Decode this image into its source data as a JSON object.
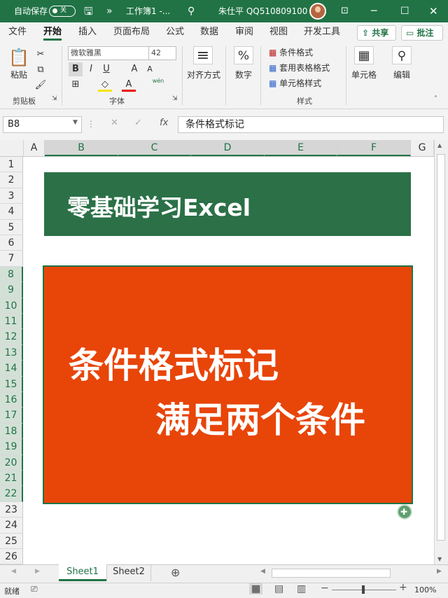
{
  "titlebar": {
    "autosave_label": "自动保存",
    "autosave_state": "关",
    "filename": "工作簿1 -...",
    "user": "朱仕平 QQ510809100",
    "chevron": "»"
  },
  "tabs": [
    "文件",
    "开始",
    "插入",
    "页面布局",
    "公式",
    "数据",
    "审阅",
    "视图",
    "开发工具"
  ],
  "active_tab": "开始",
  "share_label": "共享",
  "comment_label": "批注",
  "ribbon": {
    "paste": "粘贴",
    "clipboard": "剪贴板",
    "font_name": "微软雅黑",
    "font_size": "42",
    "font_group": "字体",
    "align": "对齐方式",
    "number": "数字",
    "number_symbol": "%",
    "cond_format": "条件格式",
    "table_format": "套用表格格式",
    "cell_style": "单元格样式",
    "styles_group": "样式",
    "cells": "单元格",
    "edit": "编辑",
    "bold": "B",
    "italic": "I",
    "underline": "U",
    "grow": "A",
    "shrink": "A",
    "wen": "wén"
  },
  "formula_bar": {
    "namebox": "B8",
    "fx": "fx",
    "formula": "条件格式标记"
  },
  "columns": [
    "A",
    "B",
    "C",
    "D",
    "E",
    "F",
    "G"
  ],
  "rows": [
    "1",
    "2",
    "3",
    "4",
    "5",
    "6",
    "7",
    "8",
    "9",
    "10",
    "11",
    "12",
    "13",
    "14",
    "15",
    "16",
    "17",
    "18",
    "19",
    "20",
    "21",
    "22",
    "23",
    "24",
    "25",
    "26"
  ],
  "cells": {
    "title": "零基础学习Excel",
    "main_line1": "条件格式标记",
    "main_line2": "满足两个条件"
  },
  "sheets": [
    "Sheet1",
    "Sheet2"
  ],
  "active_sheet": "Sheet1",
  "status": {
    "ready": "就绪",
    "zoom": "100%"
  },
  "colors": {
    "accent": "#217346",
    "title_box": "#2b7047",
    "main_box": "#e84509"
  }
}
